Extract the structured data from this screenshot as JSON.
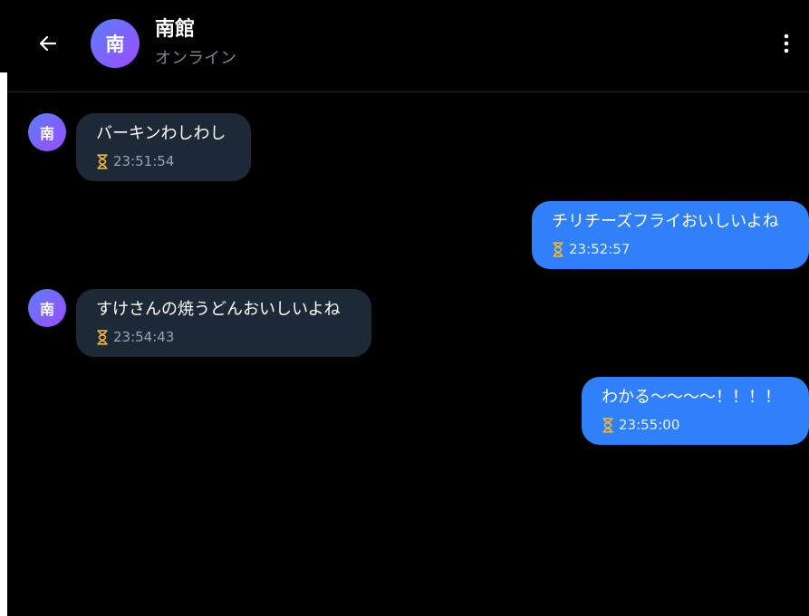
{
  "header": {
    "avatar_text": "南",
    "name": "南館",
    "status": "オンライン",
    "back_icon": "arrow-left-icon",
    "menu_icon": "more-vertical-icon"
  },
  "messages": [
    {
      "direction": "incoming",
      "avatar_text": "南",
      "text": "バーキンわしわし",
      "time": "23:51:54",
      "status_icon": "hourglass-icon"
    },
    {
      "direction": "outgoing",
      "text": "チリチーズフライおいしいよね",
      "time": "23:52:57",
      "status_icon": "hourglass-icon"
    },
    {
      "direction": "incoming",
      "avatar_text": "南",
      "text": "すけさんの焼うどんおいしいよね",
      "time": "23:54:43",
      "status_icon": "hourglass-icon"
    },
    {
      "direction": "outgoing",
      "text": "わかる〜〜〜〜！！！！",
      "time": "23:55:00",
      "status_icon": "hourglass-icon"
    }
  ],
  "colors": {
    "background": "#000000",
    "incoming_bubble": "#1e2937",
    "outgoing_bubble": "#2f80fa",
    "hourglass": "#f5b82e",
    "avatar_gradient_start": "#5b7cff",
    "avatar_gradient_end": "#9b4dff"
  }
}
